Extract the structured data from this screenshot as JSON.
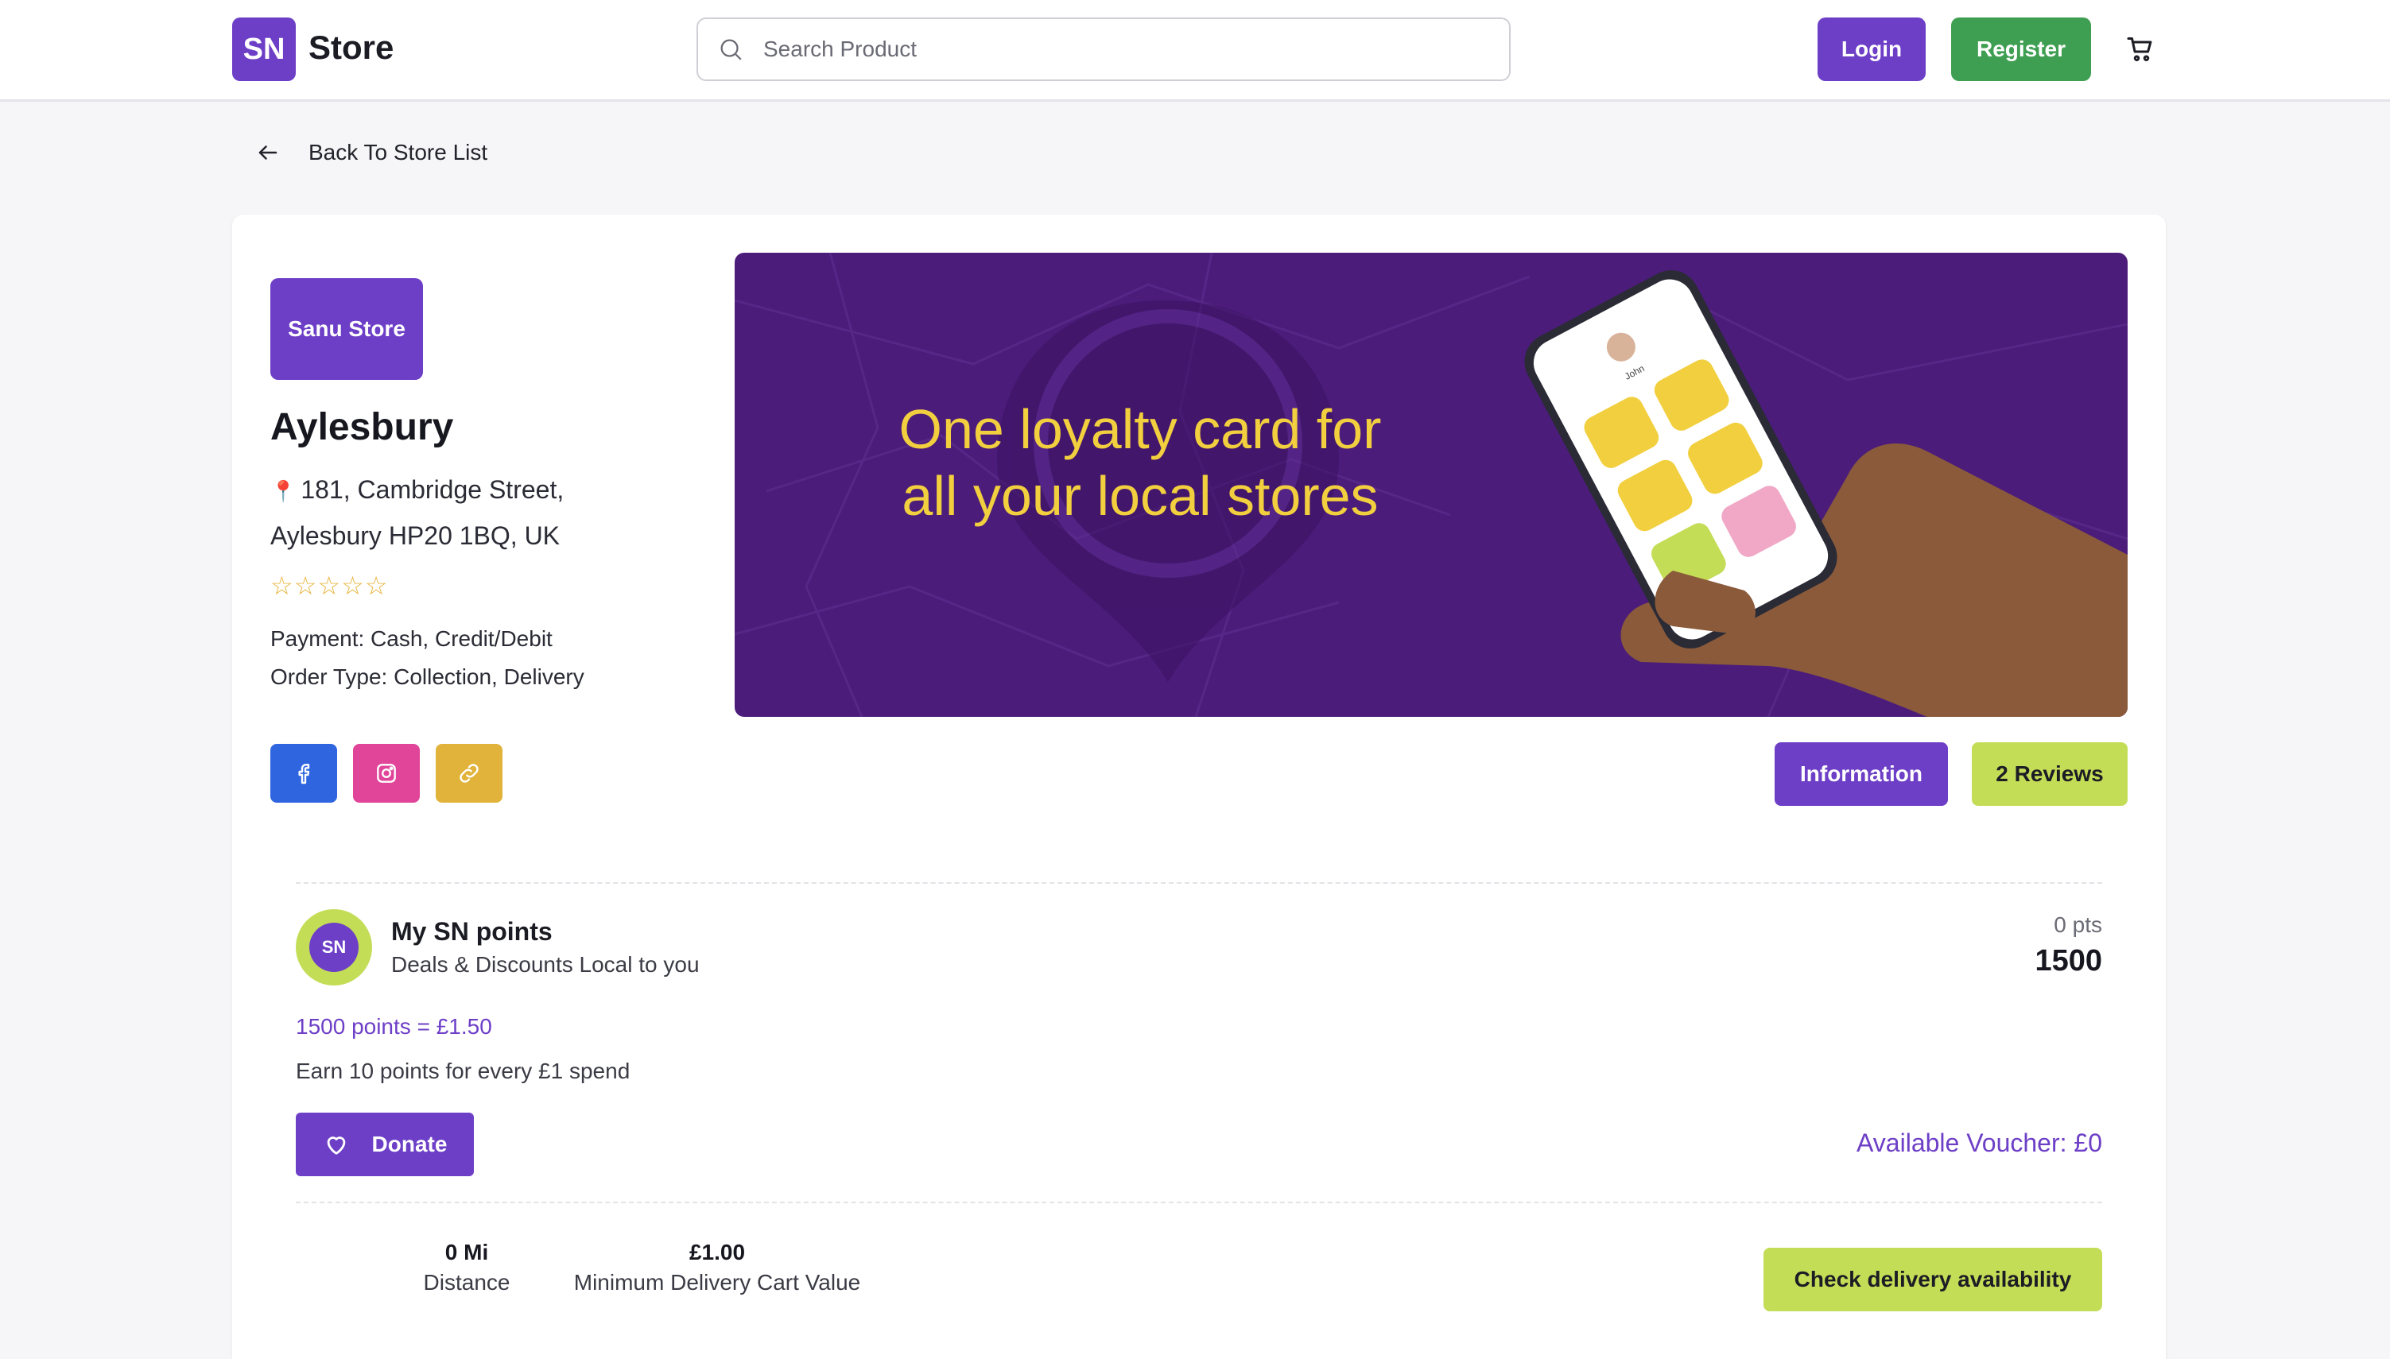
{
  "header": {
    "logo_badge": "SN",
    "logo_text": "Store",
    "search_placeholder": "Search Product",
    "login_label": "Login",
    "register_label": "Register",
    "cart_icon": "cart-icon"
  },
  "nav": {
    "back_label": "Back To Store List"
  },
  "store": {
    "badge": "Sanu Store",
    "name": "Aylesbury",
    "address_line1": "181, Cambridge Street,",
    "address_line2": "Aylesbury HP20 1BQ, UK",
    "rating_stars": "☆☆☆☆☆",
    "payment": "Payment: Cash, Credit/Debit",
    "order_type": "Order Type: Collection, Delivery"
  },
  "banner": {
    "headline_line1": "One loyalty card for",
    "headline_line2": "all your local stores",
    "phone_user_name": "John"
  },
  "tabs": {
    "information_label": "Information",
    "reviews_label": "2 Reviews"
  },
  "points": {
    "avatar": "SN",
    "title": "My SN points",
    "subtitle": "Deals & Discounts Local to you",
    "pts_label": "0 pts",
    "pts_total": "1500",
    "conversion": "1500 points = £1.50",
    "earn_rate": "Earn 10 points for every £1 spend",
    "donate_label": "Donate",
    "voucher": "Available Voucher: £0"
  },
  "delivery": {
    "distance_value": "0 Mi",
    "distance_label": "Distance",
    "min_cart_value": "£1.00",
    "min_cart_label": "Minimum Delivery Cart Value",
    "check_label": "Check delivery availability"
  },
  "colors": {
    "brand_purple": "#6d3fc7",
    "brand_green": "#3e9f52",
    "lime": "#c4dd57",
    "banner_bg": "#4b1c7a",
    "banner_text": "#f2cf3e"
  }
}
